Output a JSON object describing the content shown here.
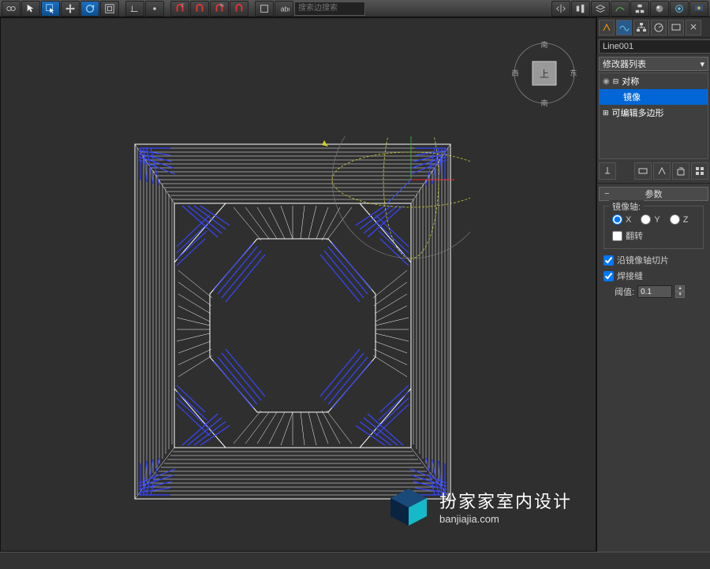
{
  "toolbar": {
    "search_placeholder": "搜索边搜索"
  },
  "viewport": {
    "axis_labels": {
      "n": "南",
      "s": "南",
      "e": "东",
      "w": "西",
      "top": "上"
    }
  },
  "panel": {
    "object_name": "Line001",
    "modifier_list_label": "修改器列表",
    "stack": [
      {
        "label": "对称",
        "expanded": true
      },
      {
        "label": "镜像",
        "selected": true,
        "indent": true
      },
      {
        "label": "可编辑多边形"
      }
    ],
    "rollout_title": "参数",
    "mirror_axis_label": "镜像轴:",
    "axes": {
      "x": "X",
      "y": "Y",
      "z": "Z"
    },
    "axis_selected": "x",
    "flip_label": "翻转",
    "flip_checked": false,
    "slice_label": "沿镜像轴切片",
    "slice_checked": true,
    "weld_label": "焊接缝",
    "weld_checked": true,
    "threshold_label": "阈值:",
    "threshold_value": "0.1"
  },
  "watermark": {
    "zh": "扮家家室内设计",
    "en": "banjiajia.com"
  }
}
